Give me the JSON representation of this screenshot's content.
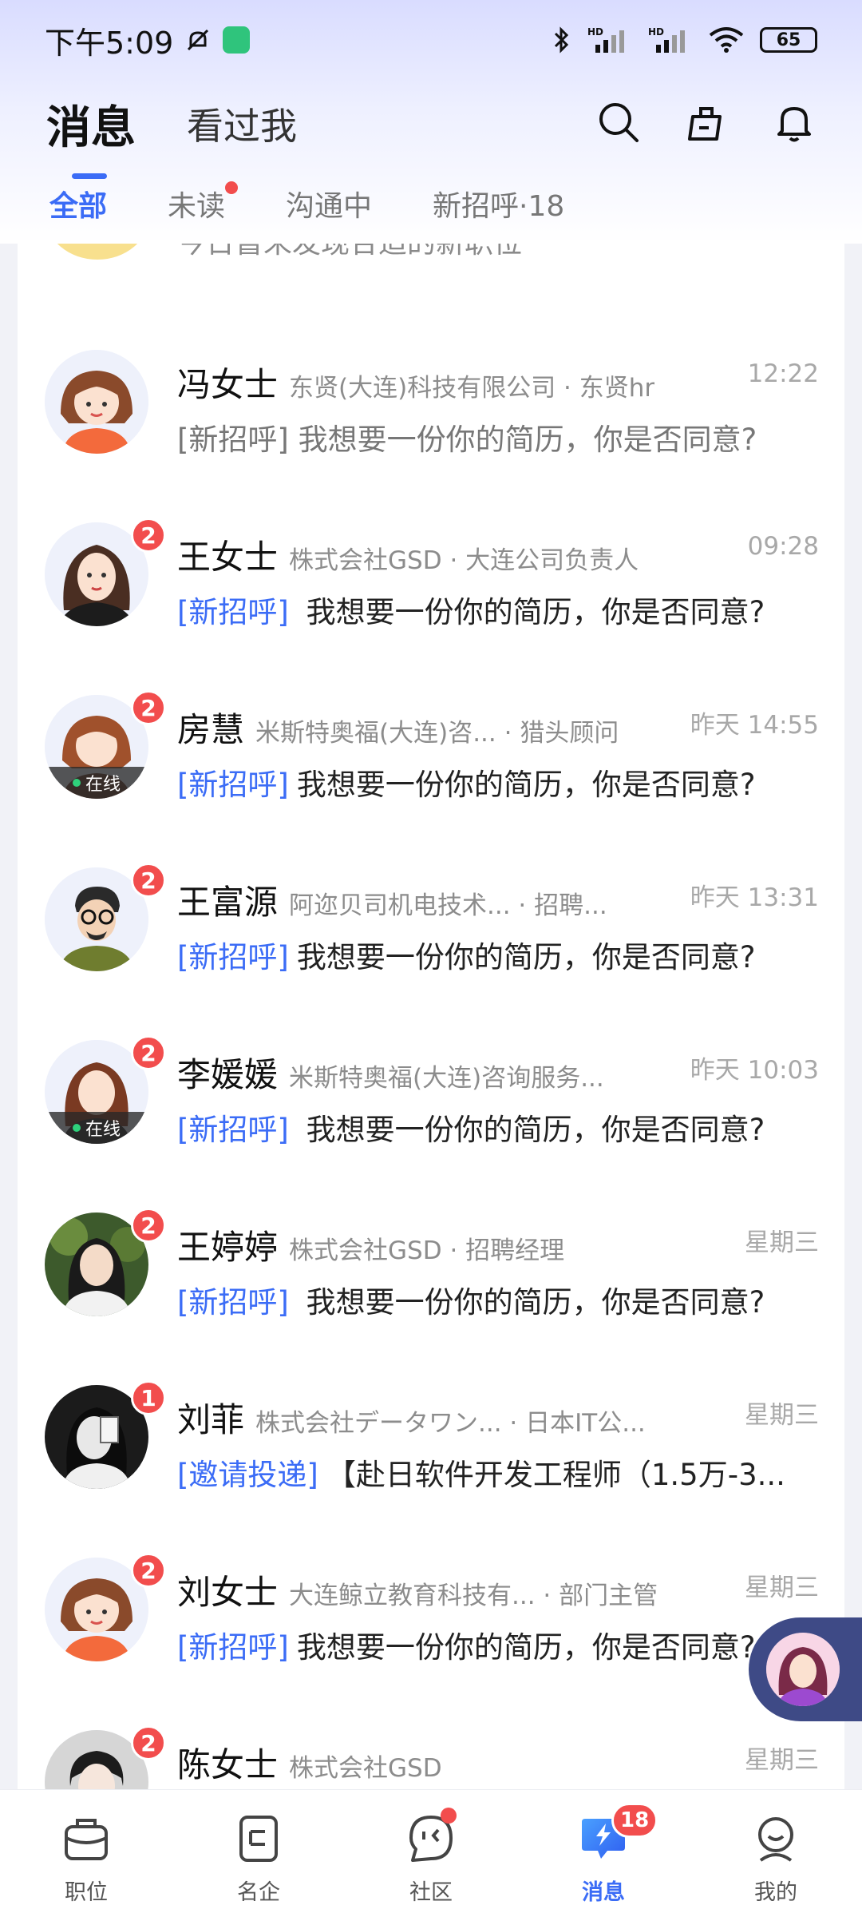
{
  "status_bar": {
    "time": "下午5:09",
    "network_1": "HD",
    "network_2": "HD",
    "battery": "65"
  },
  "header": {
    "tabs": [
      {
        "label": "消息",
        "active": true
      },
      {
        "label": "看过我",
        "active": false
      }
    ],
    "icons": [
      "search-icon",
      "briefcase-broom-icon",
      "bell-icon"
    ]
  },
  "filters": [
    {
      "label": "全部",
      "active": true
    },
    {
      "label": "未读",
      "has_dot": true
    },
    {
      "label": "沟通中"
    },
    {
      "label": "新招呼·18"
    }
  ],
  "partial_row": {
    "message": "今日暂未发现合适的新职位"
  },
  "conversations": [
    {
      "name": "冯女士",
      "company": "东贤(大连)科技有限公司 · 东贤hr",
      "time": "12:22",
      "tag": "[新招呼]",
      "message": "我想要一份你的简历，你是否同意?",
      "badge": "",
      "online": false,
      "read": true
    },
    {
      "name": "王女士",
      "company": "株式会社GSD · 大连公司负责人",
      "time": "09:28",
      "tag": "[新招呼]",
      "message": "我想要一份你的简历，你是否同意?",
      "badge": "2",
      "online": false
    },
    {
      "name": "房慧",
      "company": "米斯特奥福(大连)咨... · 猎头顾问",
      "time": "昨天 14:55",
      "tag": "[新招呼]",
      "message": "我想要一份你的简历，你是否同意?",
      "badge": "2",
      "online": true
    },
    {
      "name": "王富源",
      "company": "阿迩贝司机电技术... · 招聘...",
      "time": "昨天 13:31",
      "tag": "[新招呼]",
      "message": "我想要一份你的简历，你是否同意?",
      "badge": "2",
      "online": false
    },
    {
      "name": "李媛媛",
      "company": "米斯特奥福(大连)咨询服务...",
      "time": "昨天 10:03",
      "tag": "[新招呼]",
      "message": "我想要一份你的简历，你是否同意?",
      "badge": "2",
      "online": true
    },
    {
      "name": "王婷婷",
      "company": "株式会社GSD · 招聘经理",
      "time": "星期三",
      "tag": "[新招呼]",
      "message": "我想要一份你的简历，你是否同意?",
      "badge": "2",
      "online": false
    },
    {
      "name": "刘菲",
      "company": "株式会社データワン... · 日本IT公...",
      "time": "星期三",
      "tag": "[邀请投递]",
      "message": "【赴日软件开发工程师（1.5万-3...",
      "badge": "1",
      "online": false
    },
    {
      "name": "刘女士",
      "company": "大连鲸立教育科技有... · 部门主管",
      "time": "星期三",
      "tag": "[新招呼]",
      "message": "我想要一份你的简历，你是否同意?",
      "badge": "2",
      "online": false
    },
    {
      "name": "陈女士",
      "company": "株式会社GSD",
      "time": "星期三",
      "tag": "",
      "message": "",
      "badge": "2",
      "online": false
    }
  ],
  "online_label": "在线",
  "bottom_nav": [
    {
      "label": "职位",
      "icon": "briefcase-icon"
    },
    {
      "label": "名企",
      "icon": "company-icon"
    },
    {
      "label": "社区",
      "icon": "community-icon",
      "dot": true
    },
    {
      "label": "消息",
      "icon": "message-icon",
      "badge": "18",
      "active": true
    },
    {
      "label": "我的",
      "icon": "profile-icon"
    }
  ],
  "colors": {
    "accent": "#3b6cf6",
    "badge": "#f24d4d",
    "online": "#2fd17b"
  }
}
